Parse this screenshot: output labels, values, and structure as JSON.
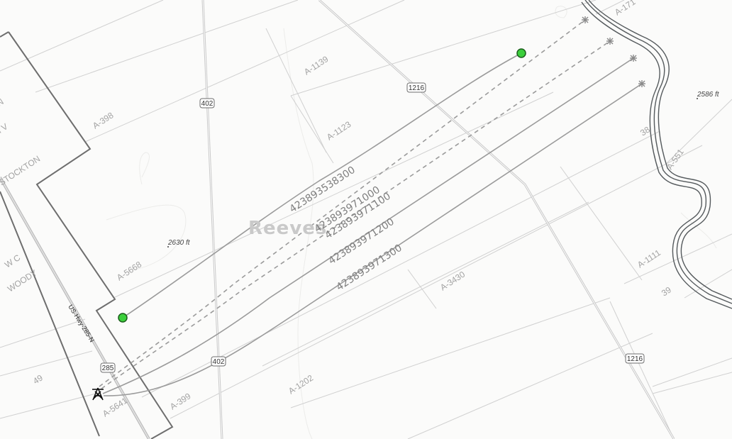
{
  "map": {
    "county_name": "Reeves",
    "survey_labels": [
      {
        "id": "a171",
        "text": "A-171"
      },
      {
        "id": "a1139",
        "text": "A-1139"
      },
      {
        "id": "a398",
        "text": "A-398"
      },
      {
        "id": "a1123",
        "text": "A-1123"
      },
      {
        "id": "a551",
        "text": "A-551"
      },
      {
        "id": "s38",
        "text": "38"
      },
      {
        "id": "a5668",
        "text": "A-5668"
      },
      {
        "id": "a1111",
        "text": "A-1111"
      },
      {
        "id": "s39",
        "text": "39"
      },
      {
        "id": "a3430",
        "text": "A-3430"
      },
      {
        "id": "s49",
        "text": "49"
      },
      {
        "id": "a1202",
        "text": "A-1202"
      },
      {
        "id": "a399",
        "text": "A-399"
      },
      {
        "id": "a5641",
        "text": "A-5641"
      }
    ],
    "owner_labels": [
      {
        "id": "in",
        "text": "IN"
      },
      {
        "id": "mv",
        "text": "M V"
      },
      {
        "id": "stockton",
        "text": "STOCKTON"
      },
      {
        "id": "wc",
        "text": "W C"
      },
      {
        "id": "woody",
        "text": "WOODY"
      }
    ],
    "elevation_labels": [
      {
        "id": "e2630",
        "text": "2630 ft"
      },
      {
        "id": "e2586",
        "text": "2586 ft"
      }
    ],
    "road_shields": [
      {
        "id": "r402a",
        "text": "402"
      },
      {
        "id": "r402b",
        "text": "402"
      },
      {
        "id": "r1216a",
        "text": "1216"
      },
      {
        "id": "r1216b",
        "text": "1216"
      },
      {
        "id": "r285",
        "text": "285"
      }
    ],
    "highway_label": "US-Hwy-285-N",
    "wells": [
      {
        "id": "w1",
        "api": "42389353830",
        "label": "423893538300",
        "status": "producing",
        "line": "solid"
      },
      {
        "id": "w2",
        "api": "42389397100",
        "label": "423893971000",
        "status": "permitted",
        "line": "dashed"
      },
      {
        "id": "w3",
        "api": "42389397110",
        "label": "423893971100",
        "status": "permitted",
        "line": "dashed"
      },
      {
        "id": "w4",
        "api": "42389397120",
        "label": "423893971200",
        "status": "drilled",
        "line": "solid"
      },
      {
        "id": "w5",
        "api": "42389397130",
        "label": "423893971300",
        "status": "drilled",
        "line": "solid"
      }
    ],
    "colors": {
      "background": "#fbfbfa",
      "county_boundary": "#6e6e6e",
      "survey_lines": "#cfcfcf",
      "well_path": "#9b9b9b",
      "surface_location": "#3ccf3c",
      "river": "#555a5d",
      "highway": "#bdbdbd"
    },
    "icons": [
      "oil-derrick-icon",
      "bottom-hole-star-icon",
      "surface-location-dot-icon"
    ]
  }
}
